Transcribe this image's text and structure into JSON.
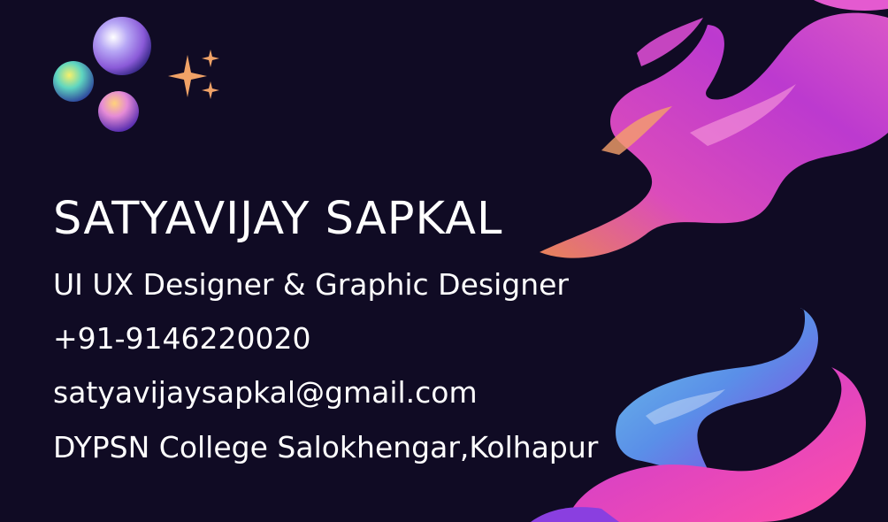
{
  "card": {
    "name": "SATYAVIJAY SAPKAL",
    "title": "UI UX Designer & Graphic Designer",
    "phone": "+91-9146220020",
    "email": "satyavijaysapkal@gmail.com",
    "address": "DYPSN College Salokhengar,Kolhapur"
  },
  "colors": {
    "background": "#100b24",
    "text": "#ffffff",
    "flame_magenta": "#e13fd0",
    "flame_orange": "#f08a4e",
    "wave_blue": "#5fb8e6",
    "wave_purple": "#7a3de0",
    "sparkle": "#f0a267"
  },
  "decorations": [
    "bubble-icon",
    "bubble-icon",
    "bubble-icon",
    "sparkle-icon",
    "flame-swirl",
    "wave-swirl"
  ]
}
